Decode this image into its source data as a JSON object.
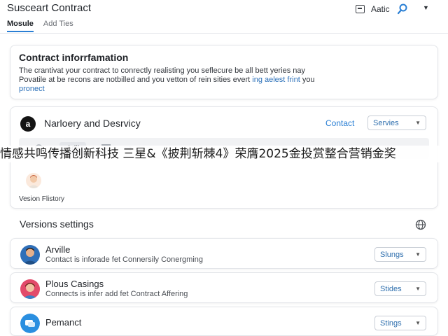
{
  "header": {
    "title": "Susceart Contract",
    "right_label": "Aatic",
    "icons": [
      "box-icon",
      "search-icon",
      "chevron-down-icon"
    ]
  },
  "tabs": [
    {
      "label": "Mosule",
      "active": true
    },
    {
      "label": "Add Ties",
      "active": false
    }
  ],
  "info": {
    "title": "Contract inforrfamation",
    "line1": "The crantivat your contract to conrectly realisting you seflecure be all bett yeries nay",
    "line2": "Povatile at be recons are notbilled and you vetton of rein sities evert",
    "line2_link": "ing aelest frint",
    "line2_end": "you",
    "line3_link": "pronect"
  },
  "nd": {
    "logo": "a",
    "title": "Narloery and Desrvicy",
    "contact": "Contact",
    "services": "Servies",
    "toolbar_add": "Adil"
  },
  "banner": "情感共鸣传播创新科技 三星&《披荆斩棘4》荣膺2025金投赏整合营销金奖",
  "version_history": "Vesion Flistory",
  "versions": {
    "title": "Versions settings",
    "rows": [
      {
        "name": "Arville",
        "desc": "Contact is inforade fet Connersily Conergming",
        "button": "Slungs"
      },
      {
        "name": "Plous Casings",
        "desc": "Connects is infer add fet Contract Affering",
        "button": "Stides"
      },
      {
        "name": "Pemanct",
        "desc": "",
        "button": "Stings"
      }
    ]
  },
  "colors": {
    "accent": "#2a7fd4",
    "link": "#2a6fb8",
    "border": "#e3e5e9"
  }
}
